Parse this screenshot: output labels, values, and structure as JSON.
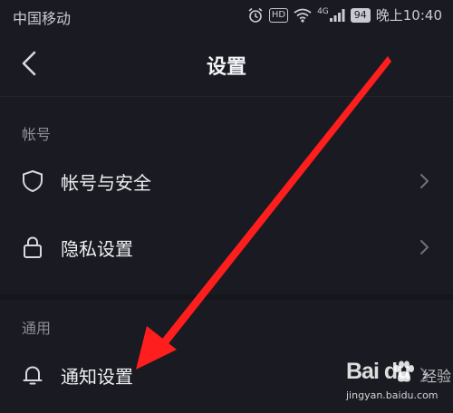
{
  "status_bar": {
    "carrier": "中国移动",
    "hd": "HD",
    "network": "4G",
    "battery": "94",
    "time": "晚上10:40"
  },
  "header": {
    "title": "设置"
  },
  "sections": [
    {
      "label": "帐号",
      "items": [
        {
          "label": "帐号与安全",
          "icon": "shield-icon"
        },
        {
          "label": "隐私设置",
          "icon": "lock-icon"
        }
      ]
    },
    {
      "label": "通用",
      "items": [
        {
          "label": "通知设置",
          "icon": "bell-icon"
        }
      ]
    }
  ],
  "watermark": {
    "brand": "Bai du",
    "suffix": "经验",
    "url": "jingyan.baidu.com"
  },
  "colors": {
    "background": "#1a1b22",
    "arrow": "#ff1e1e",
    "text": "#efeff3",
    "muted": "#8d8e98"
  }
}
